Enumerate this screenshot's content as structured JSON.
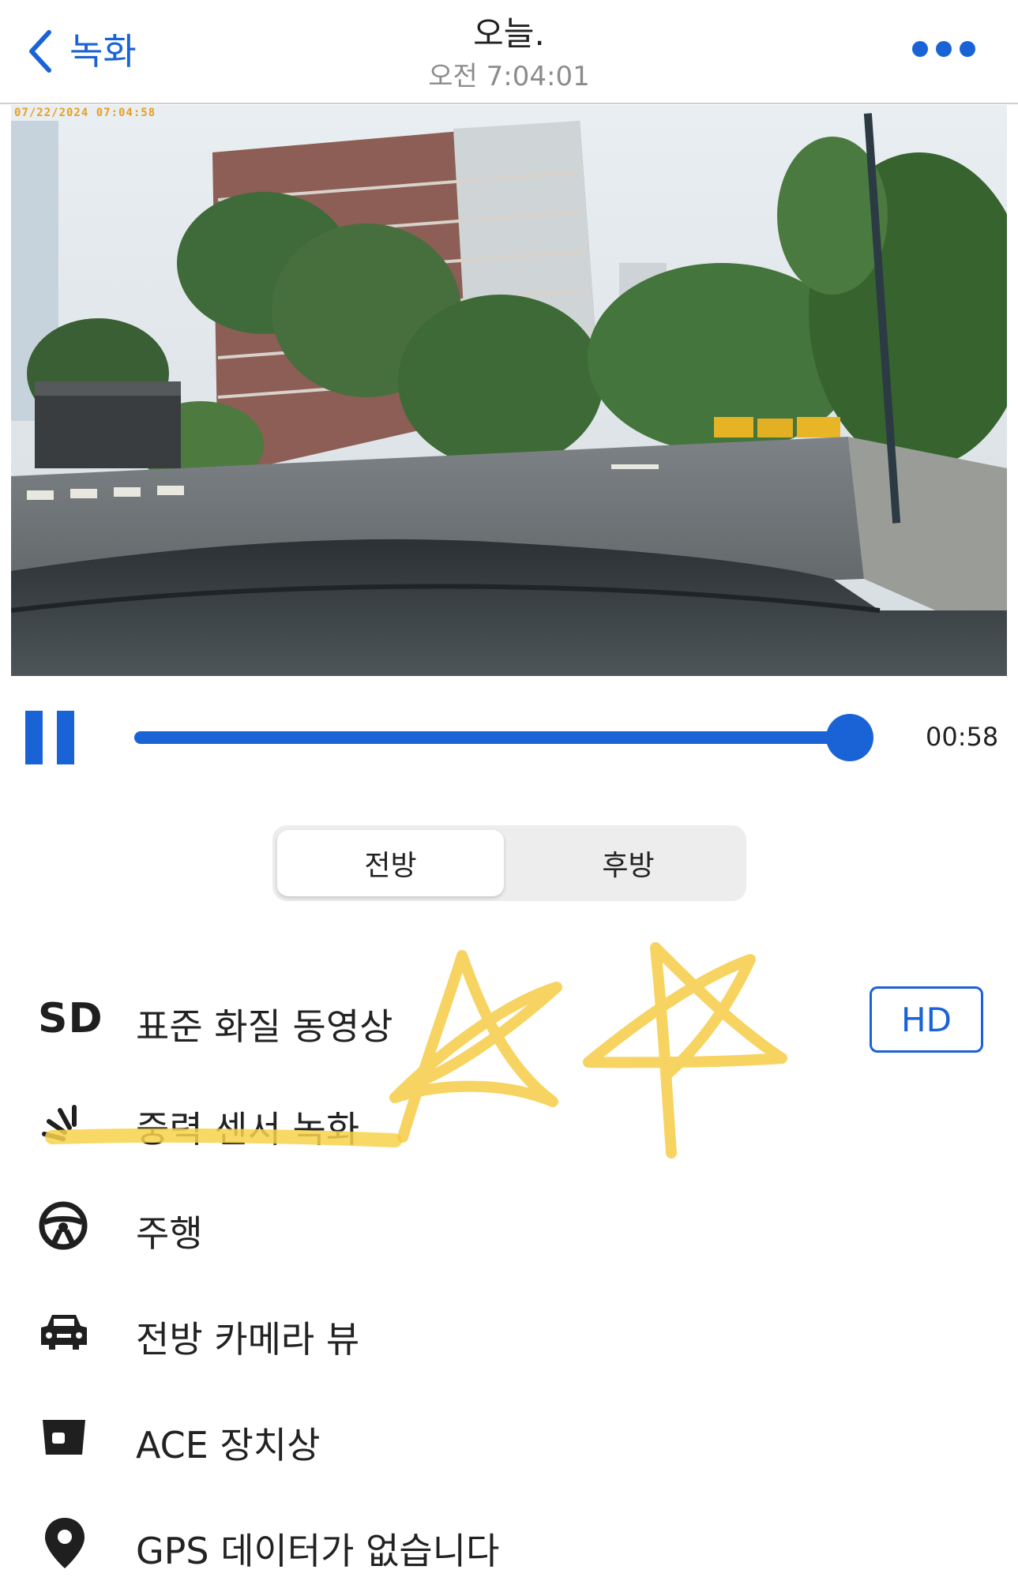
{
  "header": {
    "back_label": "녹화",
    "title": "오늘.",
    "subtitle": "오전 7:04:01"
  },
  "video": {
    "timestamp": "07/22/2024 07:04:58"
  },
  "playback": {
    "progress": 1.0,
    "duration": "00:58"
  },
  "camera_tabs": [
    {
      "label": "전방",
      "selected": true
    },
    {
      "label": "후방",
      "selected": false
    }
  ],
  "info": {
    "quality_badge": "SD",
    "quality_label": "표준 화질 동영상",
    "hd_button": "HD",
    "items": [
      {
        "icon": "impact-icon",
        "label": "중력 센서 녹화"
      },
      {
        "icon": "steering-wheel-icon",
        "label": "주행"
      },
      {
        "icon": "car-front-icon",
        "label": "전방 카메라 뷰"
      },
      {
        "icon": "dashcam-icon",
        "label": "ACE 장치상"
      },
      {
        "icon": "location-pin-icon",
        "label": "GPS 데이터가 없습니다"
      }
    ]
  },
  "colors": {
    "accent": "#1a63d6",
    "highlight": "#f7d24a"
  }
}
